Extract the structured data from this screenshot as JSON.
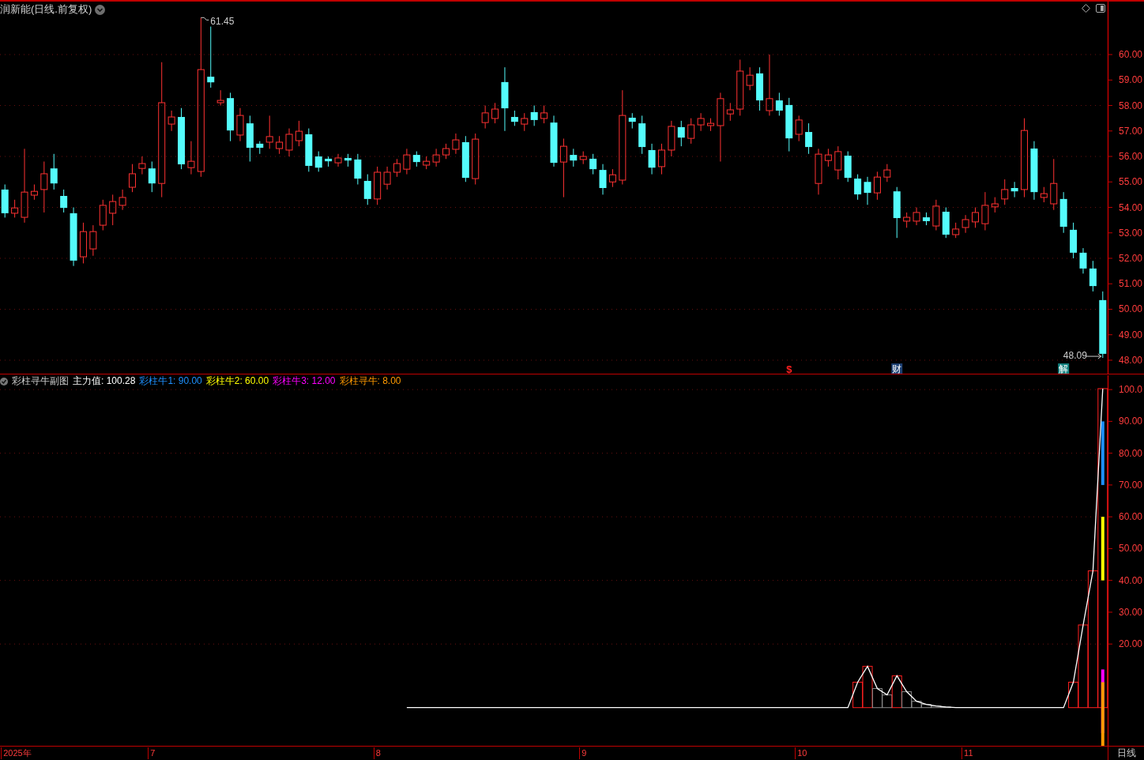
{
  "price_chart": {
    "title": "润新能(日线.前复权)",
    "events": [
      {
        "text": "$",
        "color": "#ff2020"
      },
      {
        "text": "财",
        "color": "#1c3f72"
      },
      {
        "text": "解",
        "color": "#12807e"
      }
    ],
    "chart_data": {
      "type": "candlestick",
      "ylim": [
        47.44,
        62.08
      ],
      "grid": true,
      "categories": [
        null,
        null,
        null,
        null,
        null,
        null,
        null,
        null,
        null,
        null,
        null,
        null,
        null,
        null,
        null,
        null,
        null,
        null,
        null,
        null,
        null,
        null,
        null,
        null,
        null,
        null,
        null,
        null,
        null,
        null,
        null,
        null,
        null,
        null,
        null,
        null,
        null,
        null,
        null,
        null,
        null,
        null,
        null,
        null,
        null,
        null,
        null,
        null,
        null,
        null,
        null,
        null,
        null,
        null,
        null,
        null,
        null,
        null,
        null,
        null,
        null,
        null,
        null,
        null,
        null,
        null,
        null,
        null,
        null,
        null,
        null,
        null,
        null,
        null,
        null,
        null,
        null,
        null,
        null,
        null,
        null,
        null,
        null,
        null,
        null,
        null,
        null,
        null,
        null,
        null,
        null,
        null,
        null,
        null,
        null,
        null,
        null,
        null,
        null,
        null,
        null,
        null,
        null,
        null,
        null,
        null,
        null,
        null,
        null,
        null,
        null,
        null,
        null
      ],
      "yticks": [
        {
          "value": 60,
          "label": "60.00"
        },
        {
          "value": 59,
          "label": "59.00"
        },
        {
          "value": 58,
          "label": "58.00"
        },
        {
          "value": 57,
          "label": "57.00"
        },
        {
          "value": 56,
          "label": "56.00"
        },
        {
          "value": 55,
          "label": "55.00"
        },
        {
          "value": 54,
          "label": "54.00"
        },
        {
          "value": 53,
          "label": "53.00"
        },
        {
          "value": 52,
          "label": "52.00"
        },
        {
          "value": 51,
          "label": "51.00"
        },
        {
          "value": 50,
          "label": "50.00"
        },
        {
          "value": 49,
          "label": "49.00"
        },
        {
          "value": 48,
          "label": "48.00"
        }
      ],
      "ohlc": [
        [
          54.7,
          54.9,
          53.6,
          53.77
        ],
        [
          53.77,
          54.3,
          53.6,
          53.98
        ],
        [
          53.61,
          56.3,
          53.4,
          54.6
        ],
        [
          54.48,
          54.9,
          54.3,
          54.63
        ],
        [
          54.7,
          55.8,
          53.8,
          55.32
        ],
        [
          55.53,
          56.1,
          54.7,
          54.94
        ],
        [
          54.45,
          54.7,
          53.8,
          53.98
        ],
        [
          53.77,
          54.0,
          51.7,
          51.91
        ],
        [
          52.06,
          53.4,
          51.8,
          53.05
        ],
        [
          52.37,
          53.3,
          52.1,
          53.05
        ],
        [
          53.3,
          54.3,
          53.1,
          54.08
        ],
        [
          53.77,
          54.5,
          53.3,
          54.23
        ],
        [
          54.08,
          54.7,
          53.9,
          54.39
        ],
        [
          54.79,
          55.7,
          54.6,
          55.32
        ],
        [
          55.53,
          56.0,
          55.3,
          55.72
        ],
        [
          55.53,
          55.8,
          54.6,
          54.94
        ],
        [
          54.94,
          59.7,
          54.4,
          58.11
        ],
        [
          57.27,
          57.8,
          57.0,
          57.55
        ],
        [
          57.55,
          57.9,
          55.5,
          55.69
        ],
        [
          55.56,
          56.6,
          55.3,
          55.81
        ],
        [
          55.41,
          61.45,
          55.2,
          59.41
        ],
        [
          59.13,
          61.1,
          58.7,
          58.91
        ],
        [
          58.11,
          58.6,
          58.0,
          58.2
        ],
        [
          58.29,
          58.5,
          56.6,
          57.02
        ],
        [
          56.84,
          57.9,
          56.6,
          57.61
        ],
        [
          57.3,
          57.6,
          55.8,
          56.34
        ],
        [
          56.5,
          56.6,
          56.1,
          56.34
        ],
        [
          56.56,
          57.6,
          56.3,
          56.78
        ],
        [
          56.31,
          56.8,
          56.1,
          56.56
        ],
        [
          56.25,
          57.1,
          56.0,
          56.87
        ],
        [
          56.62,
          57.4,
          56.4,
          56.99
        ],
        [
          56.87,
          57.1,
          55.4,
          55.63
        ],
        [
          56.0,
          56.2,
          55.4,
          55.56
        ],
        [
          55.91,
          56.0,
          55.6,
          55.81
        ],
        [
          55.75,
          56.1,
          55.6,
          55.94
        ],
        [
          55.94,
          56.1,
          55.6,
          55.84
        ],
        [
          55.88,
          56.1,
          54.9,
          55.13
        ],
        [
          55.04,
          55.3,
          54.1,
          54.33
        ],
        [
          54.33,
          55.6,
          54.1,
          55.38
        ],
        [
          54.91,
          55.6,
          54.7,
          55.38
        ],
        [
          55.38,
          55.9,
          55.2,
          55.72
        ],
        [
          55.5,
          56.3,
          55.3,
          56.06
        ],
        [
          56.06,
          56.2,
          55.6,
          55.78
        ],
        [
          55.66,
          56.0,
          55.5,
          55.81
        ],
        [
          55.78,
          56.3,
          55.6,
          56.06
        ],
        [
          56.06,
          56.5,
          55.9,
          56.31
        ],
        [
          56.28,
          56.9,
          56.1,
          56.65
        ],
        [
          56.56,
          56.8,
          55.0,
          55.16
        ],
        [
          55.13,
          56.9,
          54.9,
          56.68
        ],
        [
          57.33,
          58.0,
          57.1,
          57.71
        ],
        [
          57.49,
          58.1,
          57.3,
          57.86
        ],
        [
          58.92,
          59.5,
          57.0,
          57.89
        ],
        [
          57.55,
          57.8,
          57.2,
          57.36
        ],
        [
          57.27,
          57.7,
          57.0,
          57.49
        ],
        [
          57.74,
          58.0,
          57.2,
          57.43
        ],
        [
          57.49,
          58.0,
          57.3,
          57.71
        ],
        [
          57.33,
          57.6,
          55.6,
          55.75
        ],
        [
          55.78,
          56.7,
          54.4,
          56.4
        ],
        [
          56.06,
          56.3,
          55.6,
          55.84
        ],
        [
          55.88,
          56.2,
          55.7,
          56.0
        ],
        [
          55.91,
          56.1,
          55.3,
          55.5
        ],
        [
          55.47,
          55.7,
          54.5,
          54.76
        ],
        [
          55.0,
          55.5,
          54.8,
          55.28
        ],
        [
          55.07,
          58.6,
          54.9,
          57.61
        ],
        [
          57.52,
          57.7,
          57.1,
          57.36
        ],
        [
          57.3,
          57.6,
          56.1,
          56.37
        ],
        [
          56.25,
          56.5,
          55.3,
          55.56
        ],
        [
          55.6,
          56.5,
          55.3,
          56.25
        ],
        [
          56.25,
          57.4,
          56.0,
          57.18
        ],
        [
          57.15,
          57.4,
          56.4,
          56.74
        ],
        [
          56.71,
          57.5,
          56.5,
          57.24
        ],
        [
          57.24,
          57.7,
          57.0,
          57.49
        ],
        [
          57.21,
          57.5,
          57.0,
          57.3
        ],
        [
          57.21,
          58.5,
          55.8,
          58.27
        ],
        [
          57.67,
          58.1,
          57.4,
          57.83
        ],
        [
          57.86,
          59.8,
          57.6,
          59.35
        ],
        [
          58.79,
          59.5,
          58.6,
          59.19
        ],
        [
          59.26,
          59.5,
          57.8,
          58.2
        ],
        [
          57.8,
          60.0,
          57.6,
          58.27
        ],
        [
          58.2,
          58.5,
          57.6,
          57.8
        ],
        [
          58.02,
          58.3,
          56.2,
          56.71
        ],
        [
          56.87,
          57.6,
          56.6,
          57.43
        ],
        [
          56.96,
          57.3,
          56.1,
          56.37
        ],
        [
          54.94,
          56.3,
          54.5,
          56.09
        ],
        [
          55.84,
          56.3,
          55.6,
          56.06
        ],
        [
          55.47,
          56.4,
          55.1,
          56.19
        ],
        [
          56.03,
          56.2,
          55.0,
          55.16
        ],
        [
          55.13,
          55.3,
          54.3,
          54.51
        ],
        [
          55.0,
          55.2,
          54.1,
          54.57
        ],
        [
          54.57,
          55.4,
          54.3,
          55.19
        ],
        [
          55.19,
          55.7,
          55.0,
          55.47
        ],
        [
          54.63,
          54.8,
          52.8,
          53.58
        ],
        [
          53.46,
          53.8,
          53.2,
          53.61
        ],
        [
          53.46,
          54.0,
          53.3,
          53.8
        ],
        [
          53.61,
          53.8,
          53.3,
          53.46
        ],
        [
          53.27,
          54.3,
          53.1,
          54.05
        ],
        [
          53.83,
          54.0,
          52.8,
          52.93
        ],
        [
          52.93,
          53.4,
          52.8,
          53.15
        ],
        [
          53.21,
          53.7,
          53.0,
          53.52
        ],
        [
          53.43,
          54.0,
          53.2,
          53.8
        ],
        [
          53.36,
          54.6,
          53.1,
          54.08
        ],
        [
          54.02,
          54.4,
          53.8,
          54.14
        ],
        [
          54.33,
          55.1,
          54.1,
          54.7
        ],
        [
          54.76,
          55.0,
          54.4,
          54.63
        ],
        [
          54.7,
          57.5,
          54.4,
          57.02
        ],
        [
          56.31,
          56.6,
          54.3,
          54.6
        ],
        [
          54.39,
          54.8,
          54.2,
          54.54
        ],
        [
          54.14,
          55.9,
          53.9,
          54.94
        ],
        [
          54.33,
          54.6,
          53.0,
          53.24
        ],
        [
          53.12,
          53.4,
          52.0,
          52.22
        ],
        [
          52.22,
          52.4,
          51.4,
          51.6
        ],
        [
          51.6,
          51.9,
          50.7,
          50.91
        ],
        [
          50.36,
          50.7,
          48.09,
          48.25
        ]
      ],
      "annotations": [
        "61.45",
        "48.09"
      ]
    }
  },
  "indicator": {
    "title": "彩柱寻牛副图",
    "main_value": "100.28",
    "legend": [
      {
        "label": "彩柱牛1:",
        "value": "90.00",
        "color": "#1e90ff"
      },
      {
        "label": "彩柱牛2:",
        "value": "60.00",
        "color": "#ffff00"
      },
      {
        "label": "彩柱牛3:",
        "value": "12.00",
        "color": "#ff00ff"
      },
      {
        "label": "彩柱寻牛:",
        "value": "8.00",
        "color": "#ff9900"
      }
    ],
    "chart_data": {
      "type": "line",
      "ylim": [
        -11.5,
        105
      ],
      "grid": true,
      "yticks": [
        {
          "value": 100,
          "label": "100.0"
        },
        {
          "value": 90,
          "label": "90.00"
        },
        {
          "value": 80,
          "label": "80.00"
        },
        {
          "value": 70,
          "label": "70.00"
        },
        {
          "value": 60,
          "label": "60.00"
        },
        {
          "value": 50,
          "label": "50.00"
        },
        {
          "value": 40,
          "label": "40.00"
        },
        {
          "value": 30,
          "label": "30.00"
        },
        {
          "value": 20,
          "label": "20.00"
        }
      ],
      "series": [
        {
          "name": "主力值:",
          "color": "#ffffff",
          "values": [
            null,
            null,
            null,
            null,
            null,
            null,
            null,
            null,
            null,
            null,
            null,
            null,
            null,
            null,
            null,
            null,
            null,
            null,
            null,
            null,
            null,
            null,
            null,
            null,
            null,
            null,
            null,
            null,
            null,
            null,
            null,
            null,
            null,
            null,
            null,
            null,
            null,
            null,
            null,
            null,
            null,
            0,
            0,
            0,
            0,
            0,
            0,
            0,
            0,
            0,
            0,
            0,
            0,
            0,
            0,
            0,
            0,
            0,
            0,
            0,
            0,
            0,
            0,
            0,
            0,
            0,
            0,
            0,
            0,
            0,
            0,
            0,
            0,
            0,
            0,
            0,
            0,
            0,
            0,
            0,
            0,
            0,
            0,
            0,
            0,
            0,
            0,
            8,
            13,
            6,
            4,
            10,
            5,
            2,
            1,
            0.5,
            0.2,
            0,
            0,
            0,
            0,
            0,
            0,
            0,
            0,
            0,
            0,
            0,
            0,
            8,
            26,
            43,
            100.3
          ]
        }
      ]
    }
  },
  "time_axis": [
    "2025年",
    "7",
    "8",
    "9",
    "10",
    "11"
  ],
  "period_button": "日线"
}
